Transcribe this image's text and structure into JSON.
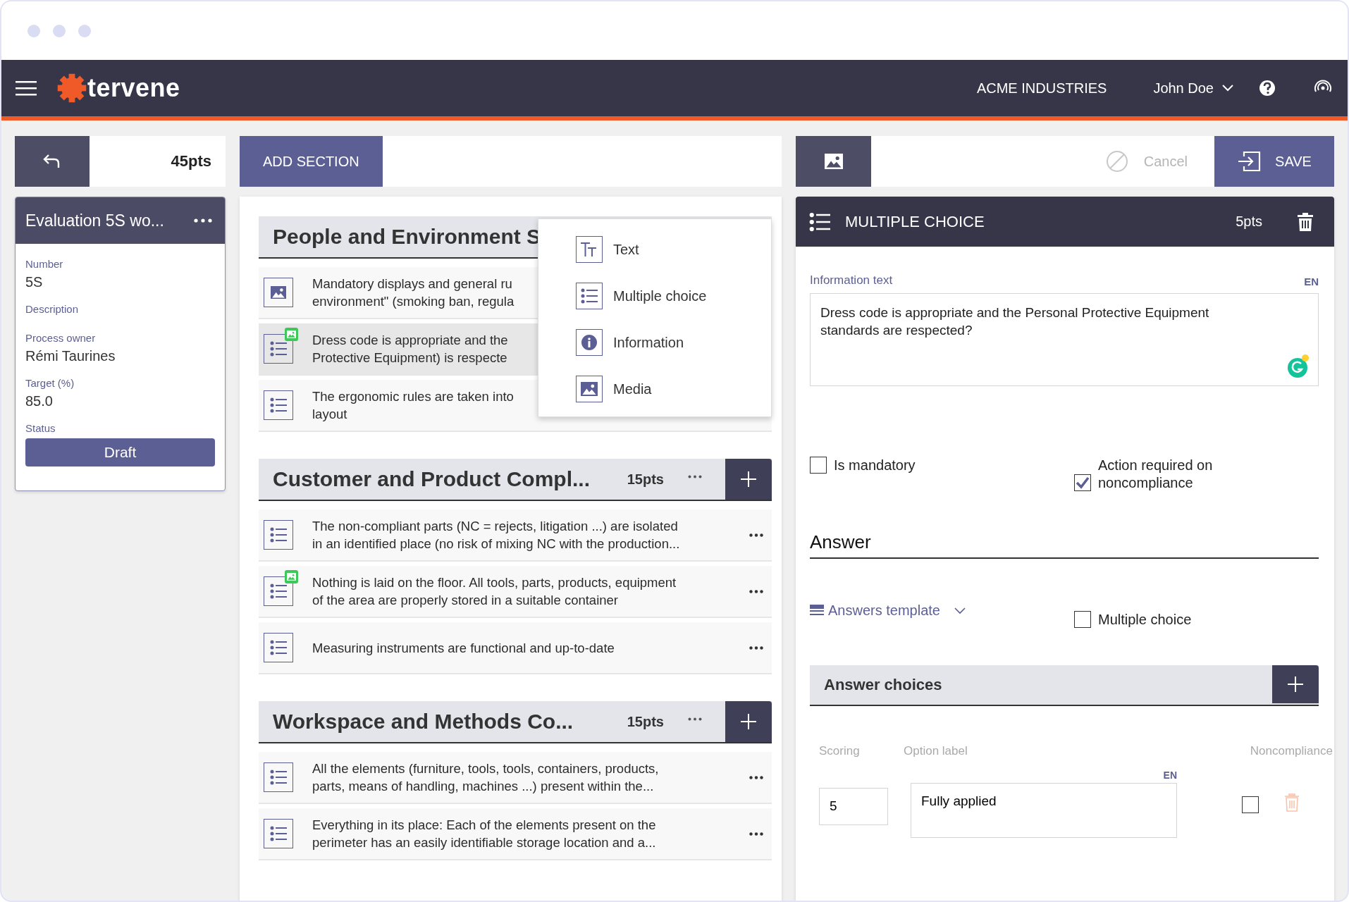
{
  "header": {
    "brand": "tervene",
    "company": "ACME INDUSTRIES",
    "user": "John Doe"
  },
  "left_toolbar": {
    "points": "45pts"
  },
  "evaluation": {
    "title": "Evaluation 5S wo...",
    "fields": [
      {
        "label": "Number",
        "value": "5S"
      },
      {
        "label": "Description"
      },
      {
        "label": "Process owner",
        "value": "Rémi Taurines"
      },
      {
        "label": "Target (%)",
        "value": "85.0"
      }
    ],
    "status_label": "Status",
    "status": "Draft"
  },
  "builder": {
    "add_section": "ADD SECTION",
    "sections": [
      {
        "title": "People and Environment S",
        "items": [
          {
            "kind": "media",
            "has_media": false,
            "selected": false,
            "more_button": false,
            "lines": [
              "Mandatory displays and general ru",
              "environment\" (smoking ban, regula"
            ]
          },
          {
            "kind": "multiple_choice",
            "has_media": true,
            "selected": true,
            "more_button": false,
            "lines": [
              "Dress code is appropriate and the",
              "Protective Equipment) is respecte"
            ]
          },
          {
            "kind": "multiple_choice",
            "has_media": false,
            "selected": false,
            "more_button": false,
            "lines": [
              "The ergonomic rules are taken into",
              "layout"
            ]
          }
        ]
      },
      {
        "title": "Customer and Product Compl...",
        "points": "15pts",
        "items": [
          {
            "kind": "multiple_choice",
            "has_media": false,
            "selected": false,
            "more_button": true,
            "lines": [
              "The non-compliant parts (NC = rejects, litigation ...) are isolated",
              "in an identified place (no risk of mixing NC with the production..."
            ]
          },
          {
            "kind": "multiple_choice",
            "has_media": true,
            "selected": false,
            "more_button": true,
            "lines": [
              "Nothing is laid on the floor. All tools, parts, products, equipment",
              "of the area are properly stored in a suitable container"
            ]
          },
          {
            "kind": "multiple_choice",
            "has_media": false,
            "selected": false,
            "more_button": true,
            "lines": [
              "Measuring instruments are functional and up-to-date"
            ]
          }
        ]
      },
      {
        "title": "Workspace and Methods Co...",
        "points": "15pts",
        "items": [
          {
            "kind": "multiple_choice",
            "has_media": false,
            "selected": false,
            "more_button": true,
            "lines": [
              "All the elements (furniture, tools, tools, containers, products,",
              "parts, means of handling, machines ...) present within the..."
            ]
          },
          {
            "kind": "multiple_choice",
            "has_media": false,
            "selected": false,
            "more_button": true,
            "lines": [
              "Everything in its place: Each of the elements present on the",
              "perimeter has an easily identifiable storage location and a..."
            ]
          }
        ]
      }
    ]
  },
  "add_menu": {
    "items": [
      {
        "kind": "text",
        "label": "Text"
      },
      {
        "kind": "multiple_choice",
        "label": "Multiple choice"
      },
      {
        "kind": "information",
        "label": "Information"
      },
      {
        "kind": "media",
        "label": "Media"
      }
    ]
  },
  "right_toolbar": {
    "cancel": "Cancel",
    "save": "SAVE"
  },
  "question": {
    "type": "MULTIPLE CHOICE",
    "points": "5pts",
    "info_label": "Information text",
    "lang": "EN",
    "info_value": "Dress code is appropriate and the Personal Protective Equipment standards are respected?",
    "options": [
      {
        "label": "Is mandatory",
        "checked": false
      },
      {
        "label": "Action required on noncompliance",
        "checked": true
      }
    ],
    "answer_heading": "Answer",
    "template": "Answers template",
    "multiple_choice": {
      "label": "Multiple choice",
      "checked": false
    },
    "choices_title": "Answer choices",
    "columns": [
      "Scoring",
      "Option label",
      "Noncompliance"
    ],
    "choices": [
      {
        "score": "5",
        "lang": "EN",
        "label": "Fully applied",
        "noncompliance": false
      }
    ]
  }
}
